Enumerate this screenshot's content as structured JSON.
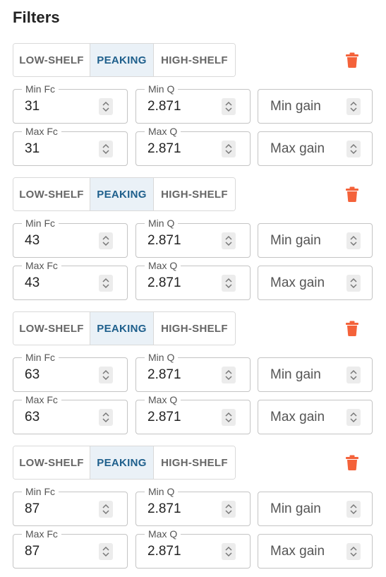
{
  "page": {
    "title": "Filters"
  },
  "icons": {
    "delete": "trash-icon",
    "spinner": "stepper-arrows-icon",
    "delete_color": "#f4623a",
    "active_tab_color": "#1e5f8c"
  },
  "filters": [
    {
      "types": [
        "LOW-SHELF",
        "PEAKING",
        "HIGH-SHELF"
      ],
      "selected": "PEAKING",
      "min_fc": {
        "label": "Min Fc",
        "value": "31"
      },
      "max_fc": {
        "label": "Max Fc",
        "value": "31"
      },
      "min_q": {
        "label": "Min Q",
        "value": "2.871"
      },
      "max_q": {
        "label": "Max Q",
        "value": "2.871"
      },
      "min_gain": {
        "placeholder": "Min gain"
      },
      "max_gain": {
        "placeholder": "Max gain"
      }
    },
    {
      "types": [
        "LOW-SHELF",
        "PEAKING",
        "HIGH-SHELF"
      ],
      "selected": "PEAKING",
      "min_fc": {
        "label": "Min Fc",
        "value": "43"
      },
      "max_fc": {
        "label": "Max Fc",
        "value": "43"
      },
      "min_q": {
        "label": "Min Q",
        "value": "2.871"
      },
      "max_q": {
        "label": "Max Q",
        "value": "2.871"
      },
      "min_gain": {
        "placeholder": "Min gain"
      },
      "max_gain": {
        "placeholder": "Max gain"
      }
    },
    {
      "types": [
        "LOW-SHELF",
        "PEAKING",
        "HIGH-SHELF"
      ],
      "selected": "PEAKING",
      "min_fc": {
        "label": "Min Fc",
        "value": "63"
      },
      "max_fc": {
        "label": "Max Fc",
        "value": "63"
      },
      "min_q": {
        "label": "Min Q",
        "value": "2.871"
      },
      "max_q": {
        "label": "Max Q",
        "value": "2.871"
      },
      "min_gain": {
        "placeholder": "Min gain"
      },
      "max_gain": {
        "placeholder": "Max gain"
      }
    },
    {
      "types": [
        "LOW-SHELF",
        "PEAKING",
        "HIGH-SHELF"
      ],
      "selected": "PEAKING",
      "min_fc": {
        "label": "Min Fc",
        "value": "87"
      },
      "max_fc": {
        "label": "Max Fc",
        "value": "87"
      },
      "min_q": {
        "label": "Min Q",
        "value": "2.871"
      },
      "max_q": {
        "label": "Max Q",
        "value": "2.871"
      },
      "min_gain": {
        "placeholder": "Min gain"
      },
      "max_gain": {
        "placeholder": "Max gain"
      }
    }
  ]
}
